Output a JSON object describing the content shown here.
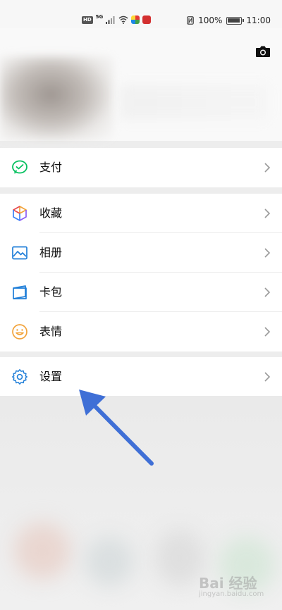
{
  "status_bar": {
    "hd": "HD",
    "network": "5G",
    "battery_text": "100%",
    "time": "11:00"
  },
  "header": {
    "camera_icon": "camera-icon"
  },
  "menu": {
    "group1": [
      {
        "label": "支付",
        "icon": "wechat-pay-icon",
        "color": "#07c160"
      }
    ],
    "group2": [
      {
        "label": "收藏",
        "icon": "favorites-cube-icon",
        "color": "#f2a33a"
      },
      {
        "label": "相册",
        "icon": "album-icon",
        "color": "#1f7ed8"
      },
      {
        "label": "卡包",
        "icon": "card-wallet-icon",
        "color": "#1f7ed8"
      },
      {
        "label": "表情",
        "icon": "emoji-icon",
        "color": "#f2a33a"
      }
    ],
    "group3": [
      {
        "label": "设置",
        "icon": "settings-gear-icon",
        "color": "#1f7ed8"
      }
    ]
  },
  "annotation": {
    "arrow_color": "#3f6fd6"
  },
  "watermark": {
    "text": "Bai 经验",
    "sub": "jingyan.baidu.com"
  }
}
